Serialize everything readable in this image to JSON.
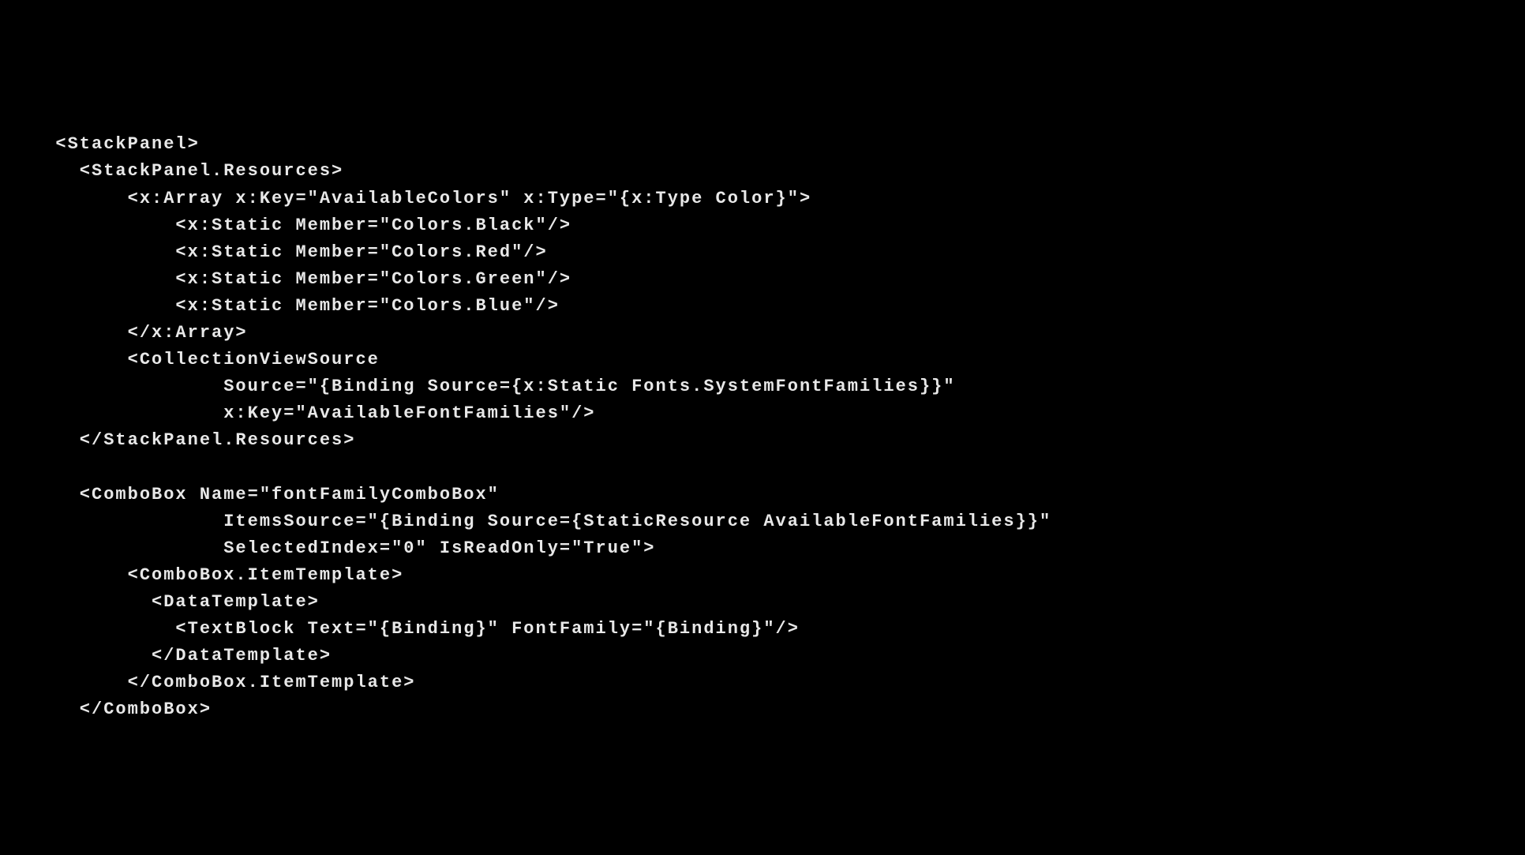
{
  "code": {
    "lines": [
      "<StackPanel>",
      "    <StackPanel.Resources>",
      "        <x:Array x:Key=\"AvailableColors\" x:Type=\"{x:Type Color}\">",
      "            <x:Static Member=\"Colors.Black\"/>",
      "            <x:Static Member=\"Colors.Red\"/>",
      "            <x:Static Member=\"Colors.Green\"/>",
      "            <x:Static Member=\"Colors.Blue\"/>",
      "        </x:Array>",
      "        <CollectionViewSource",
      "                Source=\"{Binding Source={x:Static Fonts.SystemFontFamilies}}\"",
      "                x:Key=\"AvailableFontFamilies\"/>",
      "    </StackPanel.Resources>",
      "",
      "    <ComboBox Name=\"fontFamilyComboBox\"",
      "                ItemsSource=\"{Binding Source={StaticResource AvailableFontFamilies}}\"",
      "                SelectedIndex=\"0\" IsReadOnly=\"True\">",
      "        <ComboBox.ItemTemplate>",
      "          <DataTemplate>",
      "            <TextBlock Text=\"{Binding}\" FontFamily=\"{Binding}\"/>",
      "          </DataTemplate>",
      "        </ComboBox.ItemTemplate>",
      "    </ComboBox>"
    ]
  }
}
